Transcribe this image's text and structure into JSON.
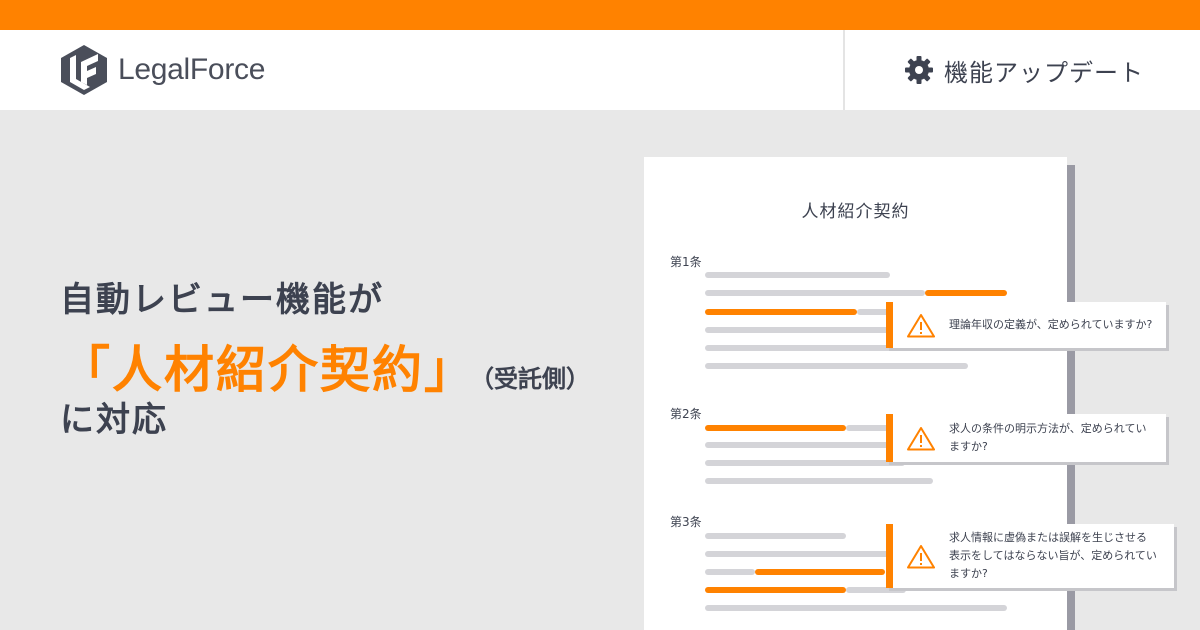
{
  "header": {
    "logo_text": "LegalForce",
    "update_label": "機能アップデート",
    "logo_icon": "legalforce-logo",
    "settings_icon": "gear-icon"
  },
  "headline": {
    "line1": "自動レビュー機能が",
    "accent": "「人材紹介契約」",
    "sub": "（受託側）",
    "line3": "に対応"
  },
  "document": {
    "title": "人材紹介契約",
    "articles": [
      {
        "label": "第1条"
      },
      {
        "label": "第2条"
      },
      {
        "label": "第3条"
      }
    ]
  },
  "callouts": [
    {
      "lines": [
        "理論年収の定義が、定められていますか?"
      ],
      "icon": "warning-icon"
    },
    {
      "lines": [
        "求人の条件の明示方法が、定められてい",
        "ますか?"
      ],
      "icon": "warning-icon"
    },
    {
      "lines": [
        "求人情報に虚偽または誤解を生じさせる",
        "表示をしてはならない旨が、定められてい",
        "ますか?"
      ],
      "icon": "warning-icon"
    }
  ],
  "colors": {
    "accent": "#ff8200",
    "text": "#3d4250",
    "background": "#e8e8e8",
    "line_gray": "#d4d4d8"
  }
}
